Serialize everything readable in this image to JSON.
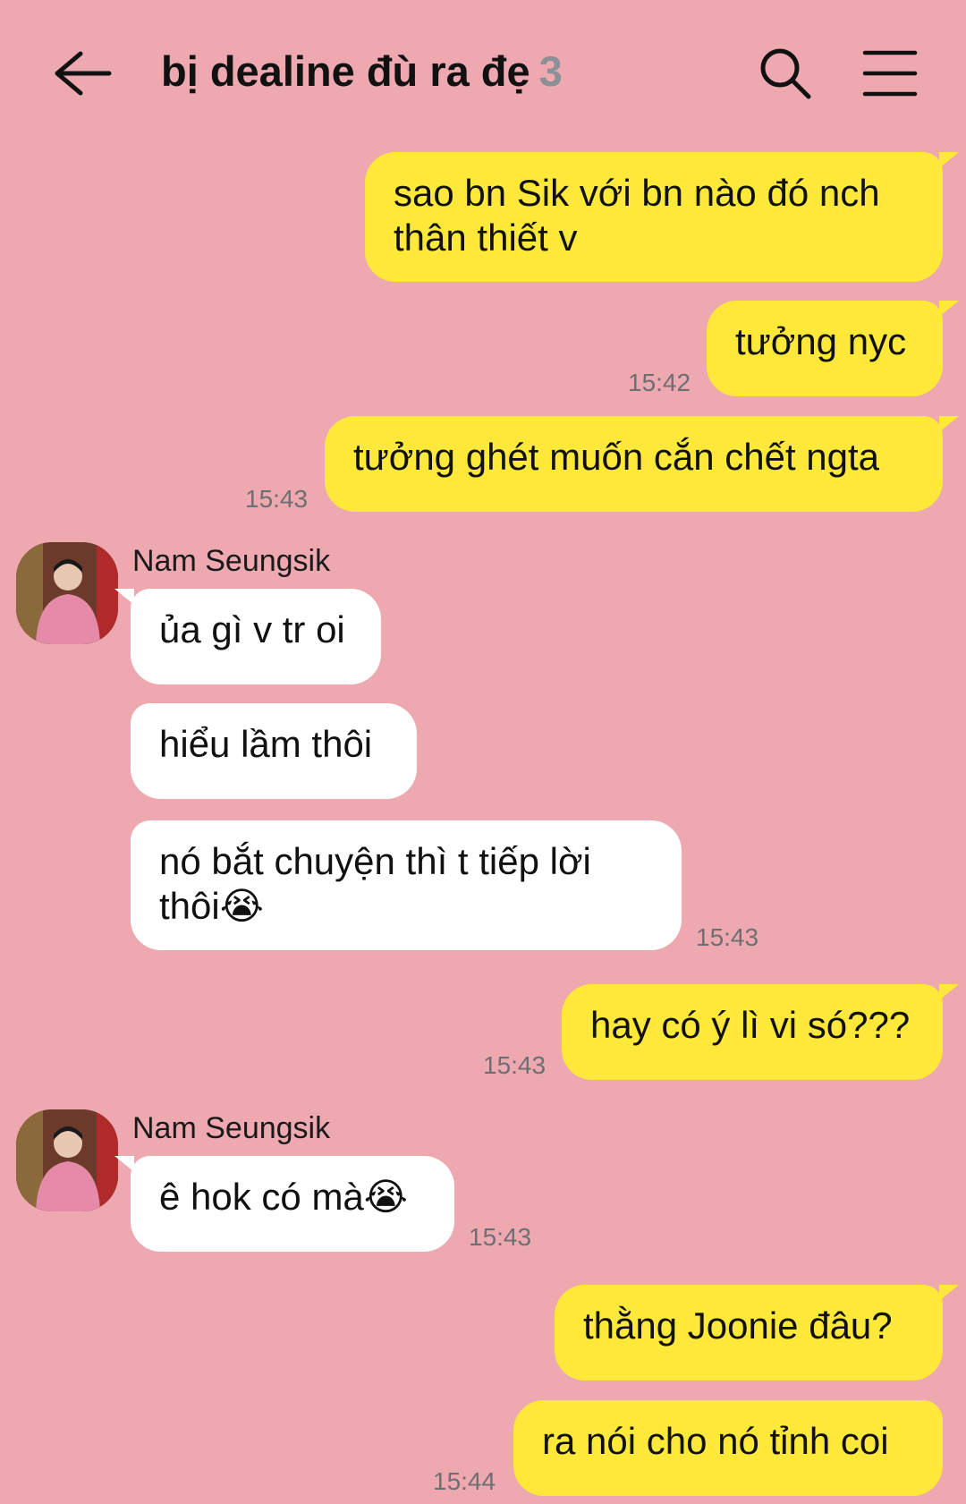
{
  "header": {
    "title": "bị dealine đù ra đẹ",
    "member_count": "3",
    "back_icon": "arrow-left-icon",
    "search_icon": "search-icon",
    "menu_icon": "hamburger-menu-icon"
  },
  "colors": {
    "background": "#EDA8B0",
    "outgoing_bubble": "#FEE93A",
    "incoming_bubble": "#FFFFFF",
    "count": "#8B8F96"
  },
  "messages": [
    {
      "from": "me",
      "text": "sao bn Sik với bn nào đó nch thân thiết v",
      "time": ""
    },
    {
      "from": "me",
      "text": "tưởng nyc",
      "time": "15:42"
    },
    {
      "from": "me",
      "text": "tưởng ghét muốn cắn chết ngta",
      "time": "15:43"
    },
    {
      "from": "Nam Seungsik",
      "sender": "Nam Seungsik",
      "text": "ủa gì v tr oi",
      "time": ""
    },
    {
      "from": "Nam Seungsik",
      "text": "hiểu lầm thôi",
      "time": ""
    },
    {
      "from": "Nam Seungsik",
      "text": "nó bắt chuyện thì t tiếp lời thôi😭",
      "time": "15:43"
    },
    {
      "from": "me",
      "text": "hay có ý lì vi só???",
      "time": "15:43"
    },
    {
      "from": "Nam Seungsik",
      "sender": "Nam Seungsik",
      "text": "ê hok có mà😭",
      "time": "15:43"
    },
    {
      "from": "me",
      "text": "thằng Joonie đâu?",
      "time": ""
    },
    {
      "from": "me",
      "text": "ra nói cho nó tỉnh coi",
      "time": "15:44"
    }
  ]
}
